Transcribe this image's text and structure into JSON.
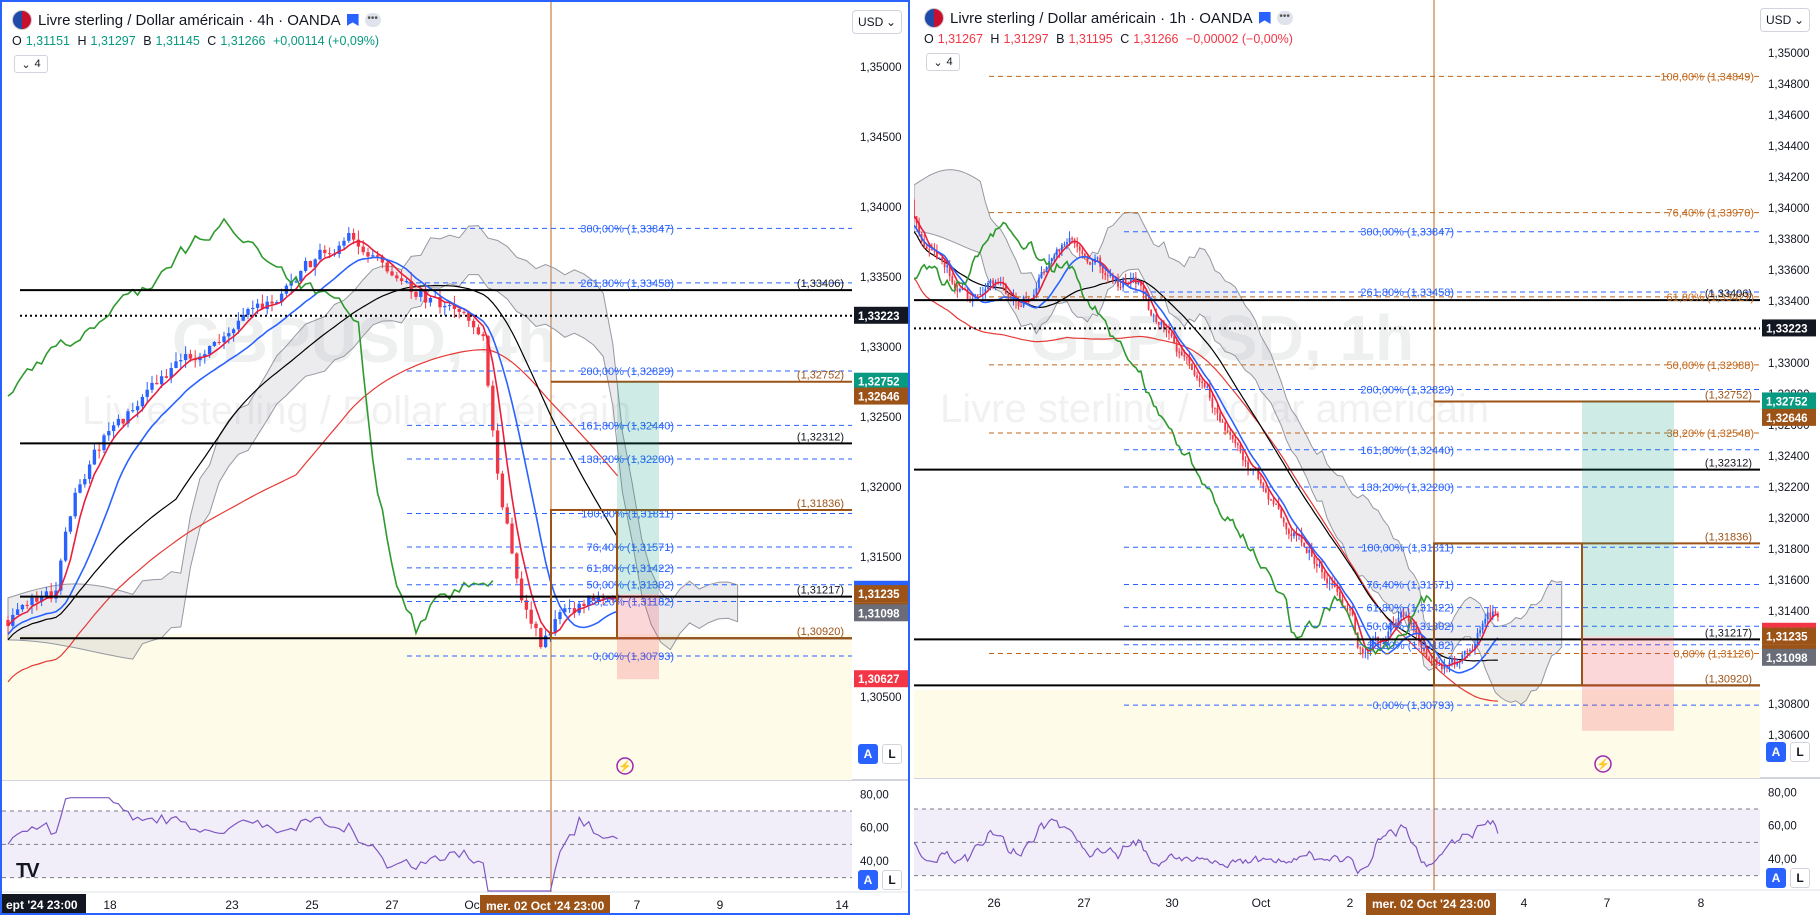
{
  "left": {
    "title": "Livre sterling / Dollar américain · 4h · OANDA",
    "currency": "USD",
    "ohlc": {
      "o_label": "O",
      "o": "1,31151",
      "h_label": "H",
      "h": "1,31297",
      "b_label": "B",
      "b": "1,31145",
      "c_label": "C",
      "c": "1,31266",
      "change": "+0,00114 (+0,09%)"
    },
    "indicator_count": "4",
    "watermark_symbol": "GBPUSD, 4h",
    "watermark_name": "Livre sterling / Dollar américain",
    "price_axis": [
      "1,35000",
      "1,34500",
      "1,34000",
      "1,33500",
      "1,33000",
      "1,32500",
      "1,32000",
      "1,31500",
      "1,30500"
    ],
    "rsi_axis": [
      "80,00",
      "60,00",
      "40,00"
    ],
    "time_axis": [
      "18",
      "23",
      "25",
      "27",
      "Oc",
      "7",
      "9",
      "14"
    ],
    "time_start": "ept '24  23:00",
    "crosshair_date": "mer. 02 Oct '24   23:00",
    "price_tags": [
      {
        "label": "1,33223",
        "kind": "black"
      },
      {
        "label": "1,32752",
        "kind": "green"
      },
      {
        "label": "1,32646",
        "kind": "brown"
      },
      {
        "label": "1,31266",
        "kind": "blue"
      },
      {
        "label": "1,31235",
        "kind": "brown"
      },
      {
        "label": "1,31235",
        "kind": "brown"
      },
      {
        "label": "1,31098",
        "kind": "grey"
      },
      {
        "label": "1,30627",
        "kind": "red"
      }
    ],
    "fib_labels": [
      "300,00% (1,33847)",
      "261,80% (1,33458)",
      "200,00% (1,32829)",
      "161,80% (1,32440)",
      "138,20% (1,32200)",
      "100,00% (1,31811)",
      "76,40% (1,31571)",
      "61,80% (1,31422)",
      "50,00% (1,31302)",
      "38,20% (1,31182)",
      "0,00% (1,30793)"
    ],
    "level_labels": [
      "(1,33406)",
      "(1,32752)",
      "(1,32312)",
      "(1,31836)",
      "(1,31217)",
      "(1,30920)"
    ],
    "alert_btn": "A",
    "log_btn": "L"
  },
  "right": {
    "title": "Livre sterling / Dollar américain · 1h · OANDA",
    "currency": "USD",
    "ohlc": {
      "o_label": "O",
      "o": "1,31267",
      "h_label": "H",
      "h": "1,31297",
      "b_label": "B",
      "b": "1,31195",
      "c_label": "C",
      "c": "1,31266",
      "change": "−0,00002 (−0,00%)"
    },
    "indicator_count": "4",
    "watermark_symbol": "GBPUSD, 1h",
    "watermark_name": "Livre sterling / Dollar américain",
    "price_axis": [
      "1,35000",
      "1,34800",
      "1,34600",
      "1,34400",
      "1,34200",
      "1,34000",
      "1,33800",
      "1,33600",
      "1,33400",
      "1,33000",
      "1,32800",
      "1,32600",
      "1,32400",
      "1,32200",
      "1,32000",
      "1,31800",
      "1,31600",
      "1,31400",
      "1,30800",
      "1,30600"
    ],
    "rsi_axis": [
      "80,00",
      "60,00",
      "40,00"
    ],
    "time_axis": [
      "26",
      "27",
      "30",
      "Oct",
      "2",
      "4",
      "7",
      "8"
    ],
    "crosshair_date": "mer. 02 Oct '24   23:00",
    "price_tags": [
      {
        "label": "1,33223",
        "kind": "black"
      },
      {
        "label": "1,32752",
        "kind": "green"
      },
      {
        "label": "1,32646",
        "kind": "brown"
      },
      {
        "label": "1,31266",
        "kind": "red"
      },
      {
        "label": "1,31235",
        "kind": "brown"
      },
      {
        "label": "1,31235",
        "kind": "brown"
      },
      {
        "label": "1,31098",
        "kind": "grey"
      }
    ],
    "fib_labels_blue": [
      "300,00% (1,33847)",
      "261,80% (1,33458)",
      "200,00% (1,32829)",
      "161,80% (1,32440)",
      "138,20% (1,32200)",
      "100,00% (1,31811)",
      "76,40% (1,31571)",
      "61,80% (1,31422)",
      "50,00% (1,31302)",
      "38,20% (1,31182)",
      "0,00% (1,30793)"
    ],
    "fib_labels_orange": [
      "100,00% (1,34849)",
      "76,40% (1,33970)",
      "61,80% (1,33427)",
      "50,00% (1,32988)",
      "38,20% (1,32548)",
      "0,00% (1,31126)"
    ],
    "level_labels": [
      "(1,33406)",
      "(1,32752)",
      "(1,32312)",
      "(1,31836)",
      "(1,31217)",
      "(1,30920)"
    ],
    "alert_btn": "A",
    "log_btn": "L"
  },
  "colors": {
    "up": "#2962ff",
    "down": "#f23645",
    "tenkan": "#e91e3b",
    "kijun": "#2962ff",
    "chikou": "#2e9a2e",
    "ma200": "#e53935",
    "ma100": "#000000",
    "fib_blue": "#2962ff",
    "fib_orange": "#c0651a",
    "rsi": "#7e57c2",
    "crosshair": "#c0651a"
  }
}
